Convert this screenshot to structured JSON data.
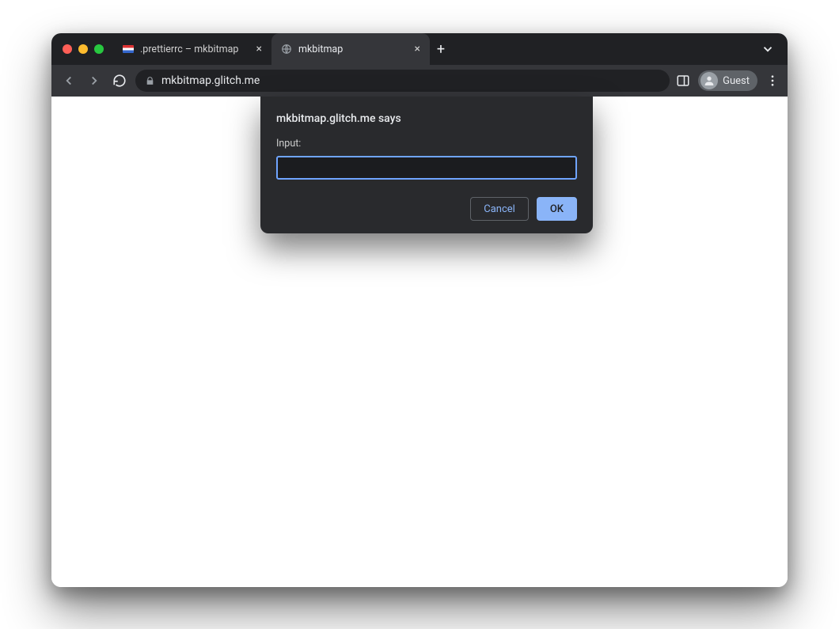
{
  "tabs": [
    {
      "title": ".prettierrc – mkbitmap",
      "active": false,
      "favicon": "stripes"
    },
    {
      "title": "mkbitmap",
      "active": true,
      "favicon": "globe"
    }
  ],
  "address_bar": {
    "url": "mkbitmap.glitch.me"
  },
  "profile": {
    "label": "Guest"
  },
  "dialog": {
    "origin_says": "mkbitmap.glitch.me says",
    "prompt_label": "Input:",
    "input_value": "",
    "cancel_label": "Cancel",
    "ok_label": "OK"
  }
}
